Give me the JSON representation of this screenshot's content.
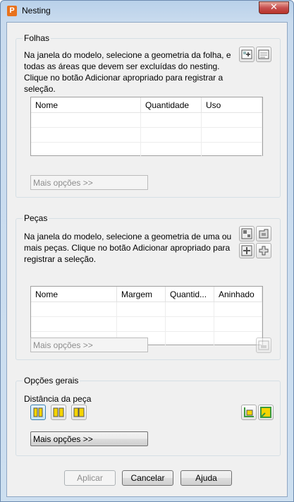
{
  "window": {
    "title": "Nesting",
    "close_glyph": "✕",
    "app_icon_letter": "P"
  },
  "sheets": {
    "title": "Folhas",
    "description": "Na janela do modelo, selecione a geometria da folha, e\ntodas as áreas que devem ser excluídas do nesting.\nClique no botão Adicionar apropriado para registrar a\nseleção.",
    "columns": [
      "Nome",
      "Quantidade",
      "Uso"
    ],
    "more_options": "Mais opções >>"
  },
  "parts": {
    "title": "Peças",
    "description": "Na janela do modelo, selecione a geometria de uma ou\nmais peças. Clique no botão Adicionar apropriado para\nregistrar a seleção.",
    "columns": [
      "Nome",
      "Margem",
      "Quantid...",
      "Aninhado"
    ],
    "more_options": "Mais opções >>"
  },
  "general": {
    "title": "Opções gerais",
    "part_distance_label": "Distância da peça",
    "more_options": "Mais opções >>"
  },
  "footer": {
    "apply": "Aplicar",
    "cancel": "Cancelar",
    "help": "Ajuda"
  },
  "icons": [
    "add-sheet-icon",
    "add-exclusion-icon",
    "add-part-icon",
    "add-part-alt-icon",
    "add-part-variant-icon",
    "add-part-group-icon",
    "part-options-icon",
    "distance-option-1-icon",
    "distance-option-2-icon",
    "distance-option-3-icon",
    "preview-icon",
    "nest-result-icon"
  ],
  "colors": {
    "accent_yellow": "#f5d400",
    "accent_green": "#3c9a3c",
    "disabled_text": "#8d8d8d"
  }
}
